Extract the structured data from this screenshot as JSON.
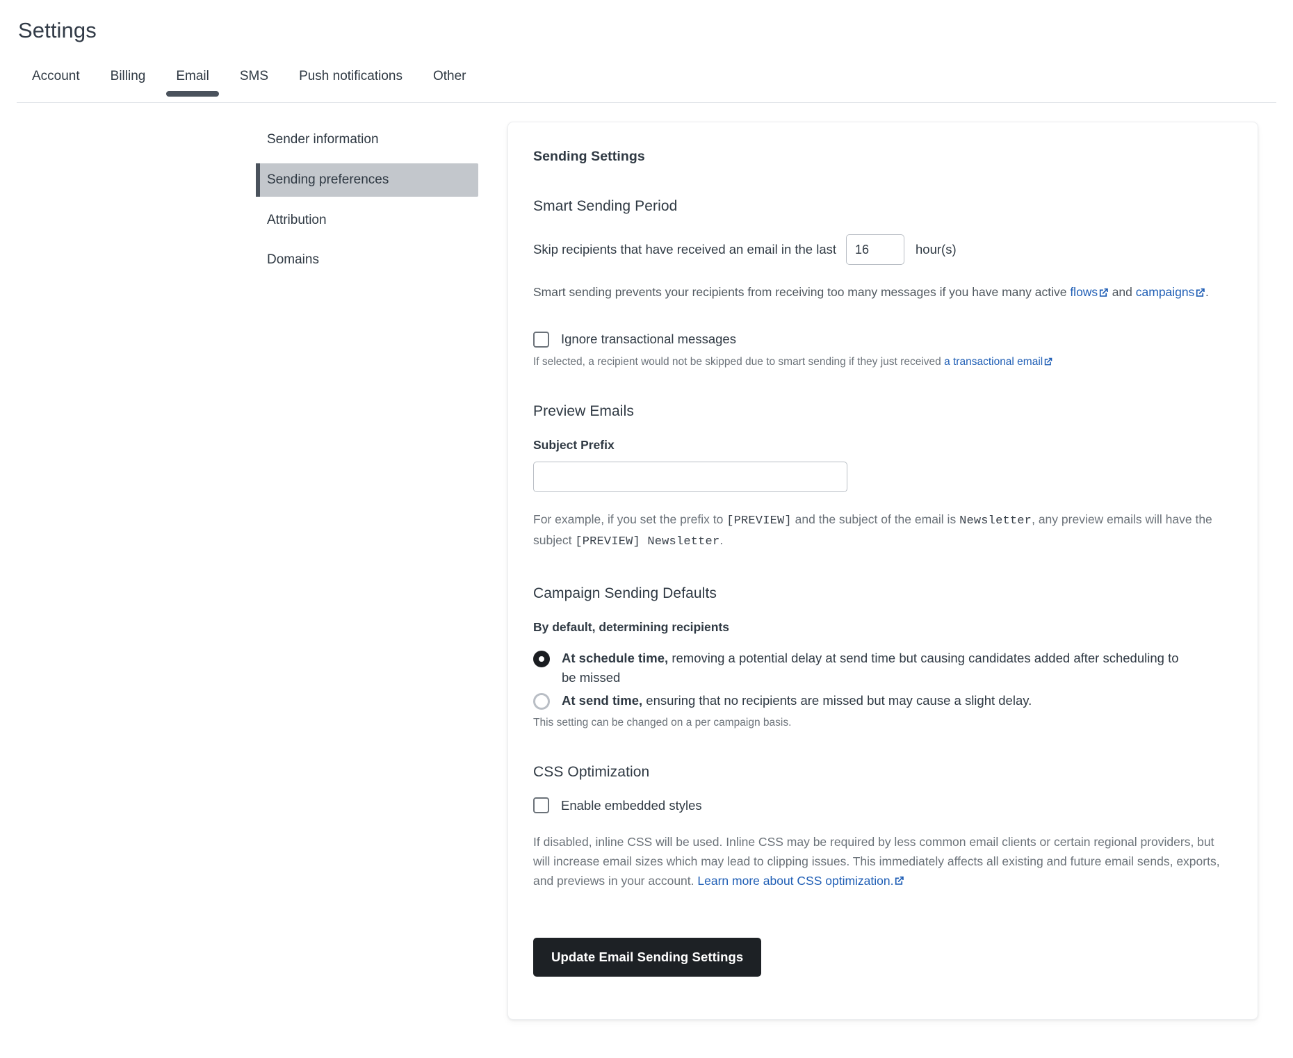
{
  "header": {
    "title": "Settings",
    "tabs": [
      {
        "label": "Account",
        "active": false
      },
      {
        "label": "Billing",
        "active": false
      },
      {
        "label": "Email",
        "active": true
      },
      {
        "label": "SMS",
        "active": false
      },
      {
        "label": "Push notifications",
        "active": false
      },
      {
        "label": "Other",
        "active": false
      }
    ]
  },
  "sidenav": {
    "items": [
      {
        "label": "Sender information",
        "selected": false
      },
      {
        "label": "Sending preferences",
        "selected": true
      },
      {
        "label": "Attribution",
        "selected": false
      },
      {
        "label": "Domains",
        "selected": false
      }
    ]
  },
  "card": {
    "title": "Sending Settings",
    "smart_sending": {
      "heading": "Smart Sending Period",
      "lead_text": "Skip recipients that have received an email in the last",
      "hours_value": "16",
      "hours_placeholder": "",
      "trailing_text": "hour(s)",
      "description_part1": "Smart sending prevents your recipients from receiving too many messages if you have many active ",
      "description_link1": "flows",
      "description_part2": " and ",
      "description_link2": "campaigns",
      "description_part3": ".",
      "checkbox_label": "Ignore transactional messages",
      "checkbox_checked": false,
      "checkbox_note_part1": "If selected, a recipient would not be skipped due to smart sending if they just received ",
      "checkbox_note_link": "a transactional email"
    },
    "preview_emails": {
      "heading": "Preview Emails",
      "subject_prefix_label": "Subject Prefix",
      "subject_prefix_value": "",
      "subject_prefix_placeholder": "",
      "example_part1": "For example, if you set the prefix to ",
      "example_code1": "[PREVIEW]",
      "example_part2": " and the subject of the email is ",
      "example_code2": "Newsletter",
      "example_part3": ", any preview emails will have the subject ",
      "example_code3": "[PREVIEW] Newsletter",
      "example_part4": "."
    },
    "campaign_defaults": {
      "heading": "Campaign Sending Defaults",
      "label": "By default, determining recipients",
      "options": [
        {
          "bold": "At schedule time,",
          "rest": " removing a potential delay at send time but causing candidates added after scheduling to be missed",
          "selected": true
        },
        {
          "bold": "At send time,",
          "rest": " ensuring that no recipients are missed but may cause a slight delay.",
          "selected": false
        }
      ],
      "note": "This setting can be changed on a per campaign basis."
    },
    "css_optimization": {
      "heading": "CSS Optimization",
      "checkbox_label": "Enable embedded styles",
      "checkbox_checked": false,
      "description_part1": "If disabled, inline CSS will be used. Inline CSS may be required by less common email clients or certain regional providers, but will increase email sizes which may lead to clipping issues. This immediately affects all existing and future email sends, exports, and previews in your account. ",
      "description_link": "Learn more about CSS optimization."
    },
    "submit_label": "Update Email Sending Settings"
  },
  "colors": {
    "link": "#1f5eb5",
    "button_bg": "#1d2125",
    "selected_nav_bg": "#c3c7cc",
    "tab_underline": "#4a525c"
  }
}
